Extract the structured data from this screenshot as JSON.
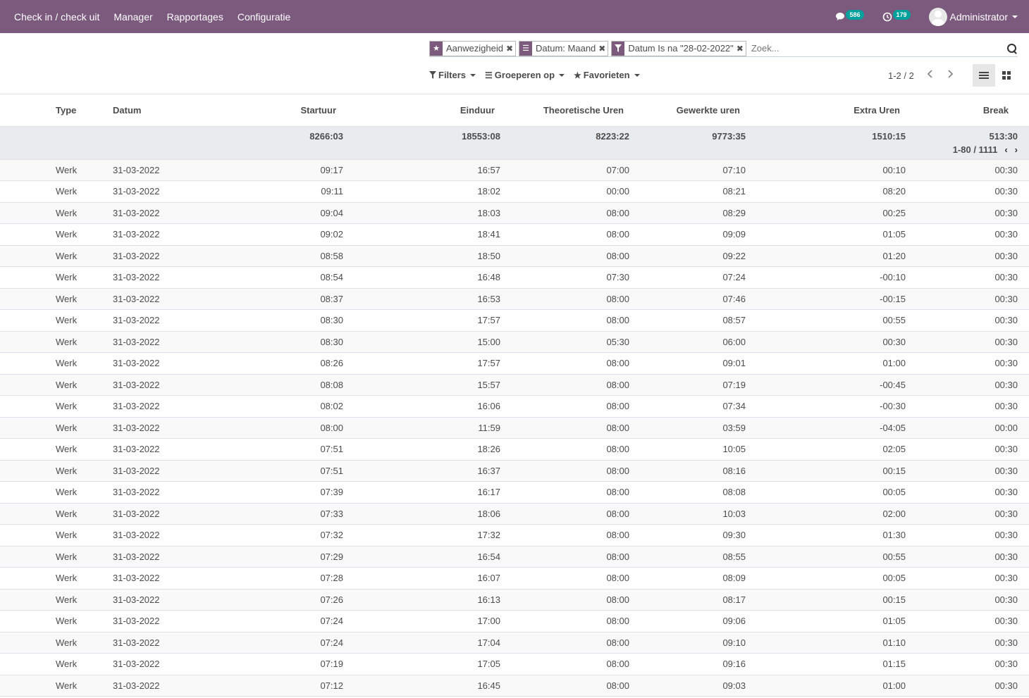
{
  "navbar": {
    "menu": [
      "Check in / check uit",
      "Manager",
      "Rapportages",
      "Configuratie"
    ],
    "messages_count": "586",
    "activities_count": "179",
    "user": "Administrator",
    "color": "#7c5a7e"
  },
  "search": {
    "facets": [
      {
        "icon": "star-icon",
        "label": "Aanwezigheid"
      },
      {
        "icon": "group-icon",
        "label": "Datum: Maand"
      },
      {
        "icon": "filter-icon",
        "label": "Datum Is na \"28-02-2022\""
      }
    ],
    "placeholder": "Zoek..."
  },
  "toolbar": {
    "filters": "Filters",
    "group_by": "Groeperen op",
    "favorites": "Favorieten",
    "pager": "1-2 / 2"
  },
  "table": {
    "headers": {
      "type": "Type",
      "date": "Datum",
      "start": "Startuur",
      "end": "Einduur",
      "theoretical": "Theoretische Uren",
      "worked": "Gewerkte uren",
      "extra": "Extra Uren",
      "break": "Break"
    },
    "group": {
      "start": "8266:03",
      "end": "18553:08",
      "theoretical": "8223:22",
      "worked": "9773:35",
      "extra": "1510:15",
      "break": "513:30",
      "pager": "1-80 / 1111"
    },
    "rows": [
      [
        "Werk",
        "31-03-2022",
        "09:17",
        "16:57",
        "07:00",
        "07:10",
        "00:10",
        "00:30"
      ],
      [
        "Werk",
        "31-03-2022",
        "09:11",
        "18:02",
        "00:00",
        "08:21",
        "08:20",
        "00:30"
      ],
      [
        "Werk",
        "31-03-2022",
        "09:04",
        "18:03",
        "08:00",
        "08:29",
        "00:25",
        "00:30"
      ],
      [
        "Werk",
        "31-03-2022",
        "09:02",
        "18:41",
        "08:00",
        "09:09",
        "01:05",
        "00:30"
      ],
      [
        "Werk",
        "31-03-2022",
        "08:58",
        "18:50",
        "08:00",
        "09:22",
        "01:20",
        "00:30"
      ],
      [
        "Werk",
        "31-03-2022",
        "08:54",
        "16:48",
        "07:30",
        "07:24",
        "-00:10",
        "00:30"
      ],
      [
        "Werk",
        "31-03-2022",
        "08:37",
        "16:53",
        "08:00",
        "07:46",
        "-00:15",
        "00:30"
      ],
      [
        "Werk",
        "31-03-2022",
        "08:30",
        "17:57",
        "08:00",
        "08:57",
        "00:55",
        "00:30"
      ],
      [
        "Werk",
        "31-03-2022",
        "08:30",
        "15:00",
        "05:30",
        "06:00",
        "00:30",
        "00:30"
      ],
      [
        "Werk",
        "31-03-2022",
        "08:26",
        "17:57",
        "08:00",
        "09:01",
        "01:00",
        "00:30"
      ],
      [
        "Werk",
        "31-03-2022",
        "08:08",
        "15:57",
        "08:00",
        "07:19",
        "-00:45",
        "00:30"
      ],
      [
        "Werk",
        "31-03-2022",
        "08:02",
        "16:06",
        "08:00",
        "07:34",
        "-00:30",
        "00:30"
      ],
      [
        "Werk",
        "31-03-2022",
        "08:00",
        "11:59",
        "08:00",
        "03:59",
        "-04:05",
        "00:00"
      ],
      [
        "Werk",
        "31-03-2022",
        "07:51",
        "18:26",
        "08:00",
        "10:05",
        "02:05",
        "00:30"
      ],
      [
        "Werk",
        "31-03-2022",
        "07:51",
        "16:37",
        "08:00",
        "08:16",
        "00:15",
        "00:30"
      ],
      [
        "Werk",
        "31-03-2022",
        "07:39",
        "16:17",
        "08:00",
        "08:08",
        "00:05",
        "00:30"
      ],
      [
        "Werk",
        "31-03-2022",
        "07:33",
        "18:06",
        "08:00",
        "10:03",
        "02:00",
        "00:30"
      ],
      [
        "Werk",
        "31-03-2022",
        "07:32",
        "17:32",
        "08:00",
        "09:30",
        "01:30",
        "00:30"
      ],
      [
        "Werk",
        "31-03-2022",
        "07:29",
        "16:54",
        "08:00",
        "08:55",
        "00:55",
        "00:30"
      ],
      [
        "Werk",
        "31-03-2022",
        "07:28",
        "16:07",
        "08:00",
        "08:09",
        "00:05",
        "00:30"
      ],
      [
        "Werk",
        "31-03-2022",
        "07:26",
        "16:13",
        "08:00",
        "08:17",
        "00:15",
        "00:30"
      ],
      [
        "Werk",
        "31-03-2022",
        "07:24",
        "17:00",
        "08:00",
        "09:06",
        "01:05",
        "00:30"
      ],
      [
        "Werk",
        "31-03-2022",
        "07:24",
        "17:04",
        "08:00",
        "09:10",
        "01:10",
        "00:30"
      ],
      [
        "Werk",
        "31-03-2022",
        "07:19",
        "17:05",
        "08:00",
        "09:16",
        "01:15",
        "00:30"
      ],
      [
        "Werk",
        "31-03-2022",
        "07:12",
        "16:45",
        "08:00",
        "09:03",
        "01:00",
        "00:30"
      ]
    ]
  }
}
